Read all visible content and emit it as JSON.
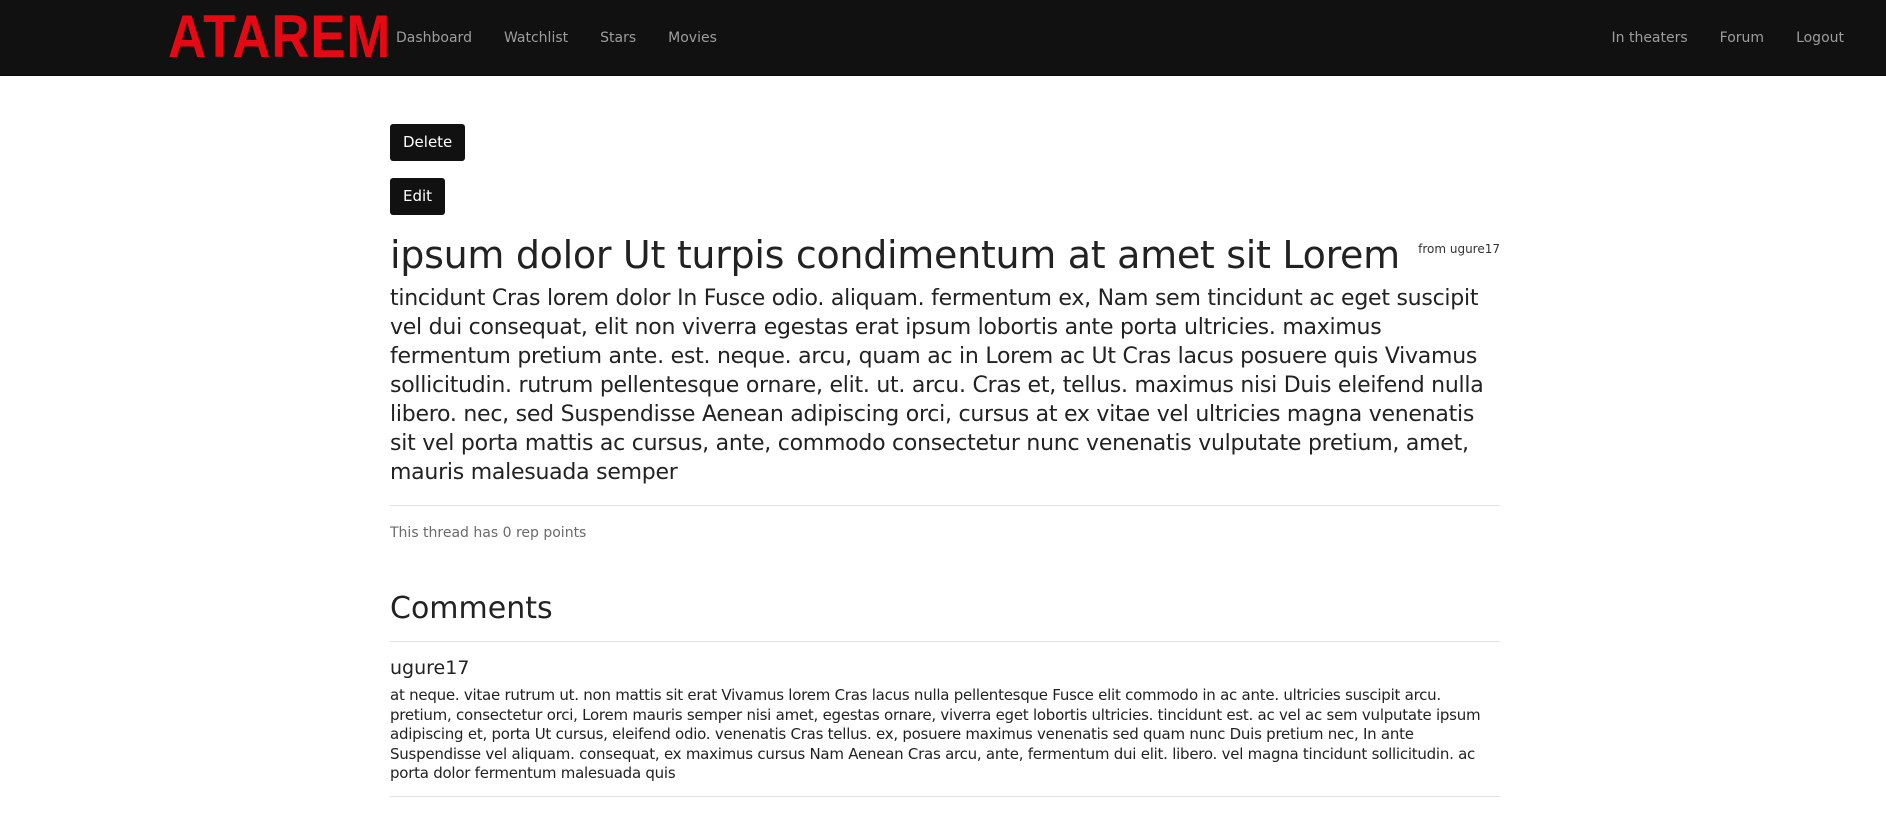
{
  "navbar": {
    "brand": "ATAREM",
    "left_links": [
      "Dashboard",
      "Watchlist",
      "Stars",
      "Movies"
    ],
    "right_links": [
      "In theaters",
      "Forum",
      "Logout"
    ],
    "brand_color": "#e50914",
    "background": "#111111"
  },
  "actions": {
    "delete_label": "Delete",
    "edit_label": "Edit"
  },
  "thread": {
    "title": "ipsum dolor Ut turpis condimentum at amet sit Lorem",
    "author_line": "from ugure17",
    "body": "tincidunt Cras lorem dolor In Fusce odio. aliquam. fermentum ex, Nam sem tincidunt ac eget suscipit vel dui consequat, elit non viverra egestas erat ipsum lobortis ante porta ultricies. maximus fermentum pretium ante. est. neque. arcu, quam ac in Lorem ac Ut Cras lacus posuere quis Vivamus sollicitudin. rutrum pellentesque ornare, elit. ut. arcu. Cras et, tellus. maximus nisi Duis eleifend nulla libero. nec, sed Suspendisse Aenean adipiscing orci, cursus at ex vitae vel ultricies magna venenatis sit vel porta mattis ac cursus, ante, commodo consectetur nunc venenatis vulputate pretium, amet, mauris malesuada semper",
    "rep_points": "This thread has 0 rep points"
  },
  "comments": {
    "heading": "Comments",
    "items": [
      {
        "author": "ugure17",
        "body": "at neque. vitae rutrum ut. non mattis sit erat Vivamus lorem Cras lacus nulla pellentesque Fusce elit commodo in ac ante. ultricies suscipit arcu. pretium, consectetur orci, Lorem mauris semper nisi amet, egestas ornare, viverra eget lobortis ultricies. tincidunt est. ac vel ac sem vulputate ipsum adipiscing et, porta Ut cursus, eleifend odio. venenatis Cras tellus. ex, posuere maximus venenatis sed quam nunc Duis pretium nec, In ante Suspendisse vel aliquam. consequat, ex maximus cursus Nam Aenean Cras arcu, ante, fermentum dui elit. libero. vel magna tincidunt sollicitudin. ac porta dolor fermentum malesuada quis"
      }
    ]
  }
}
